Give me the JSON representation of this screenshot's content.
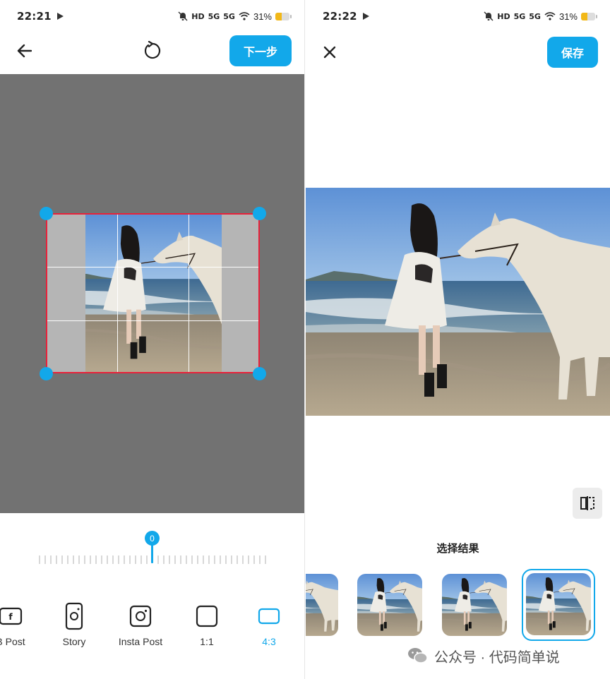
{
  "left_screen": {
    "status": {
      "time": "22:21",
      "hd": "HD",
      "net1": "5G",
      "net2": "5G",
      "battery": "31%",
      "battery_level": 0.31
    },
    "toolbar": {
      "next_label": "下一步"
    },
    "rotation_value": "0",
    "ratios": [
      {
        "label": "B Post",
        "icon": "facebook-icon",
        "active": false
      },
      {
        "label": "Story",
        "icon": "instagram-story-icon",
        "active": false
      },
      {
        "label": "Insta Post",
        "icon": "instagram-post-icon",
        "active": false
      },
      {
        "label": "1:1",
        "icon": "square-icon",
        "active": false
      },
      {
        "label": "4:3",
        "icon": "landscape-rect-icon",
        "active": true
      }
    ],
    "colors": {
      "accent": "#12a8ea",
      "crop_border": "#e8213a",
      "canvas": "#727272"
    }
  },
  "right_screen": {
    "status": {
      "time": "22:22",
      "hd": "HD",
      "net1": "5G",
      "net2": "5G",
      "battery": "31%",
      "battery_level": 0.31
    },
    "toolbar": {
      "save_label": "保存"
    },
    "choose_label": "选择结果",
    "thumbnails": [
      "result-1",
      "result-2",
      "result-3",
      "result-4"
    ],
    "selected_thumbnail": "result-4"
  },
  "watermark": {
    "text": "公众号 · 代码简单说"
  }
}
